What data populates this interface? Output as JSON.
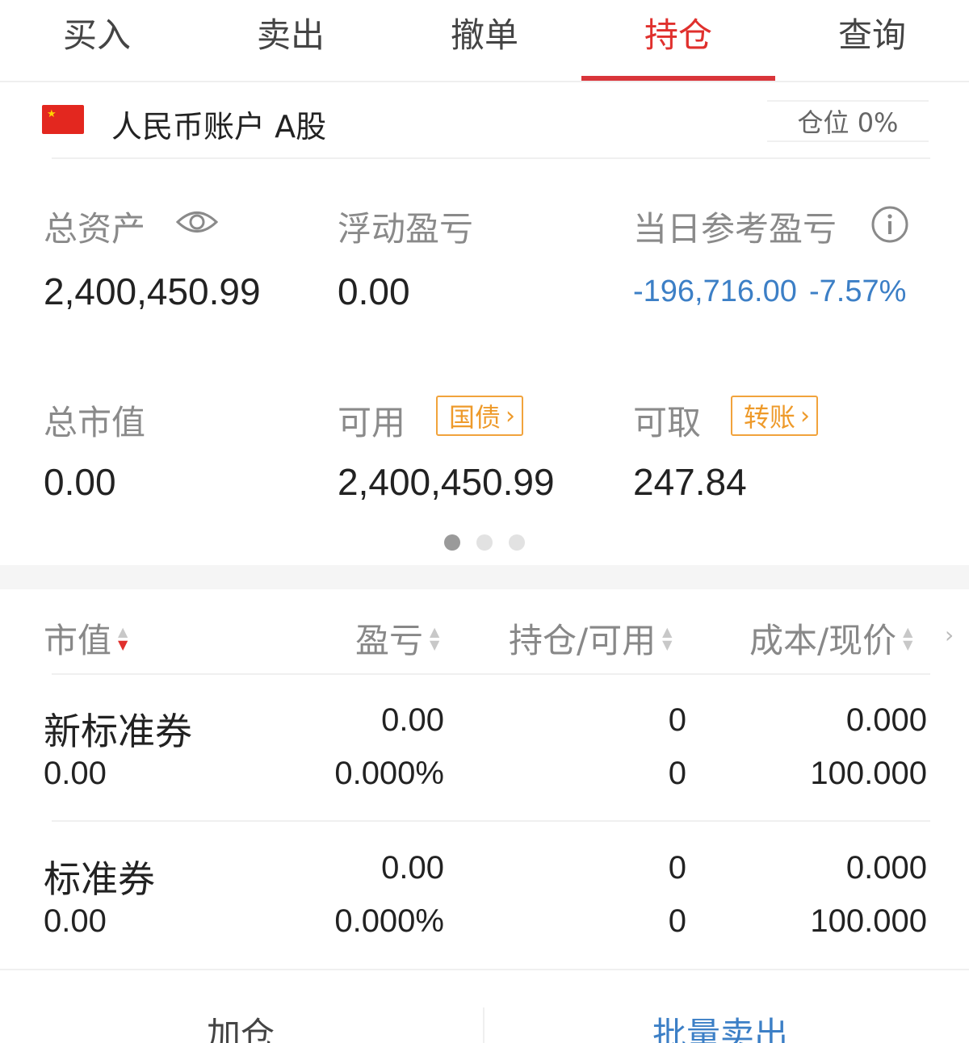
{
  "tabs": [
    {
      "label": "买入"
    },
    {
      "label": "卖出"
    },
    {
      "label": "撤单"
    },
    {
      "label": "持仓"
    },
    {
      "label": "查询"
    }
  ],
  "account": {
    "label": "人民币账户 A股",
    "position_badge": "仓位 0%"
  },
  "stats": {
    "total_assets_label": "总资产",
    "total_assets_value": "2,400,450.99",
    "floating_pl_label": "浮动盈亏",
    "floating_pl_value": "0.00",
    "daily_pl_label": "当日参考盈亏",
    "daily_pl_value": "-196,716.00",
    "daily_pl_pct": "-7.57%",
    "market_value_label": "总市值",
    "market_value_value": "0.00",
    "available_label": "可用",
    "available_tag": "国债",
    "available_value": "2,400,450.99",
    "withdrawable_label": "可取",
    "withdrawable_tag": "转账",
    "withdrawable_value": "247.84"
  },
  "table": {
    "headers": [
      "市值",
      "盈亏",
      "持仓/可用",
      "成本/现价"
    ],
    "rows": [
      {
        "name": "新标准券",
        "market_value": "0.00",
        "pl": "0.00",
        "pl_pct": "0.000%",
        "position": "0",
        "available": "0",
        "cost": "0.000",
        "price": "100.000"
      },
      {
        "name": "标准券",
        "market_value": "0.00",
        "pl": "0.00",
        "pl_pct": "0.000%",
        "position": "0",
        "available": "0",
        "cost": "0.000",
        "price": "100.000"
      }
    ]
  },
  "bottom": {
    "add_label": "加仓",
    "batch_sell_label": "批量卖出"
  },
  "colors": {
    "accent_red": "#e0302d",
    "negative_blue": "#3c7fc6",
    "tag_orange": "#ee9a2a"
  }
}
